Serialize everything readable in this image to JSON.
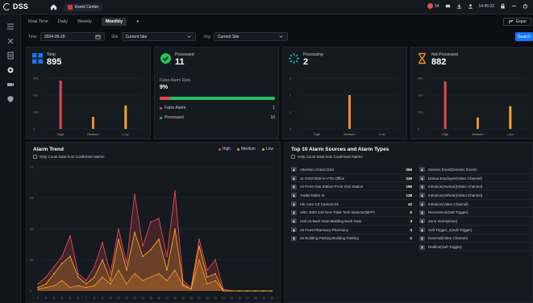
{
  "topbar": {
    "logo": "DSS",
    "tab_label": "Event Center",
    "alarm_count": "14",
    "time": "14:45:32"
  },
  "subtabs": [
    "Real Time",
    "Daily",
    "Weekly",
    "Monthly"
  ],
  "active_subtab": "Monthly",
  "export_label": "Expor",
  "filters": {
    "time_label": "Time",
    "time_value": "2024-09-20",
    "site_label": "Site",
    "site_value": "Current Site",
    "org_label": "Org",
    "org_value": "Current Site",
    "search_label": "Search"
  },
  "kpis": [
    {
      "label": "Total",
      "value": "895",
      "color": "#1677ff",
      "bars": {
        "categories": [
          "High",
          "Medium",
          "Low"
        ],
        "values": [
          380,
          95,
          185
        ],
        "colors": [
          "#e5484d",
          "#f08c2e",
          "#f5a623"
        ],
        "ymax": 400,
        "yticks": [
          "400",
          "300",
          "100",
          "0"
        ]
      }
    },
    {
      "label": "Processed",
      "value": "11",
      "color": "#2bbf5a",
      "false_alarm_label": "False Alarm Rate",
      "false_alarm_rate": "9%",
      "false_alarm_fraction": 0.09,
      "rows": [
        {
          "label": "False Alarm",
          "value": "1",
          "color": "#e5484d"
        },
        {
          "label": "Processed",
          "value": "10",
          "color": "#2bbf5a"
        }
      ]
    },
    {
      "label": "Processing",
      "value": "2",
      "color": "#1fb6c4",
      "bars": {
        "categories": [
          "High",
          "Medium",
          "Low"
        ],
        "values": [
          0,
          2,
          0
        ],
        "colors": [
          "#e5484d",
          "#f08c2e",
          "#f5a623"
        ],
        "ymax": 3,
        "yticks": [
          "3",
          "2",
          "1",
          "0"
        ]
      }
    },
    {
      "label": "Not Processed",
      "value": "882",
      "color": "#f08c2e",
      "bars": {
        "categories": [
          "High",
          "Medium",
          "Low"
        ],
        "values": [
          375,
          90,
          180
        ],
        "colors": [
          "#e5484d",
          "#f08c2e",
          "#f5a623"
        ],
        "ymax": 400,
        "yticks": [
          "400",
          "300",
          "100",
          "0"
        ]
      }
    }
  ],
  "trend": {
    "title": "Alarm Trend",
    "checkbox": "Only Count Data from Confirmed Alarms",
    "legend": [
      {
        "name": "High",
        "color": "#e5484d"
      },
      {
        "name": "Medium",
        "color": "#f08c2e"
      },
      {
        "name": "Low",
        "color": "#f5a623"
      }
    ]
  },
  "chart_data": {
    "type": "area",
    "title": "Alarm Trend",
    "x": [
      "1",
      "2",
      "3",
      "4",
      "5",
      "6",
      "7",
      "8",
      "9",
      "10",
      "11",
      "12",
      "13",
      "14",
      "15",
      "16",
      "17",
      "18",
      "19",
      "20",
      "21",
      "22",
      "23",
      "24",
      "25",
      "26",
      "27",
      "28",
      "29",
      "30"
    ],
    "ylim": [
      0,
      72
    ],
    "yticks": [
      "72",
      "54",
      "36",
      "18",
      "0"
    ],
    "series": [
      {
        "name": "High",
        "values": [
          4,
          8,
          14,
          20,
          32,
          10,
          6,
          14,
          28,
          10,
          36,
          16,
          56,
          26,
          40,
          42,
          20,
          58,
          6,
          2,
          30,
          12,
          18,
          1,
          0,
          0,
          0,
          0,
          0,
          0
        ]
      },
      {
        "name": "Medium",
        "values": [
          1,
          2,
          3,
          6,
          2,
          3,
          2,
          3,
          8,
          4,
          12,
          4,
          10,
          6,
          8,
          10,
          6,
          12,
          3,
          1,
          18,
          4,
          6,
          0,
          0,
          0,
          0,
          0,
          0,
          0
        ]
      },
      {
        "name": "Low",
        "values": [
          2,
          4,
          10,
          16,
          20,
          8,
          4,
          8,
          18,
          6,
          30,
          12,
          34,
          20,
          24,
          30,
          12,
          36,
          4,
          1,
          26,
          8,
          10,
          0,
          0,
          0,
          0,
          0,
          0,
          0
        ]
      }
    ]
  },
  "top10": {
    "title": "Top 10 Alarm Sources and Alarm Types",
    "checkbox": "Only Count Data from Confirmed Alarms",
    "sources": [
      {
        "name": "Attention Check DSS",
        "value": "266"
      },
      {
        "name": "11 IVSS7008-1I-VTO Office",
        "value": "249"
      },
      {
        "name": "24 Front Gas Station-Front Gas Station",
        "value": "196"
      },
      {
        "name": "Trailer-trailer In",
        "value": "138"
      },
      {
        "name": "Hik Cam CZ Camera 01",
        "value": "42"
      },
      {
        "name": "ARC 3000 2nd Gen-Triple Tech Detector(BPP)",
        "value": "5"
      },
      {
        "name": "Ctel 24 Back Gate-Building Back Gate",
        "value": "3"
      },
      {
        "name": "23 Front Pharmacy-Pharmacy",
        "value": "3"
      },
      {
        "name": "25 Building Parking-Building Parking",
        "value": "2"
      }
    ],
    "types": [
      {
        "name": "Generic Event(Generic Event)",
        "value": "26"
      },
      {
        "name": "Dahua Employee(Video Channel)",
        "value": "24"
      },
      {
        "name": "Intrusion(Human)(Video Channel)",
        "value": "24"
      },
      {
        "name": "Intrusion(Vehicle)(Video Channel)",
        "value": "4"
      },
      {
        "name": "Intrusion(Video Channel)",
        "value": "4"
      },
      {
        "name": "Recurrence(Soft Trigger)",
        "value": "2"
      },
      {
        "name": "Zone Alarm(Zone)",
        "value": ""
      },
      {
        "name": "Soft Trigger_1(Soft Trigger)",
        "value": ""
      },
      {
        "name": "External(Video Channel)",
        "value": ""
      },
      {
        "name": "Redline(Soft Trigger)",
        "value": ""
      }
    ]
  }
}
